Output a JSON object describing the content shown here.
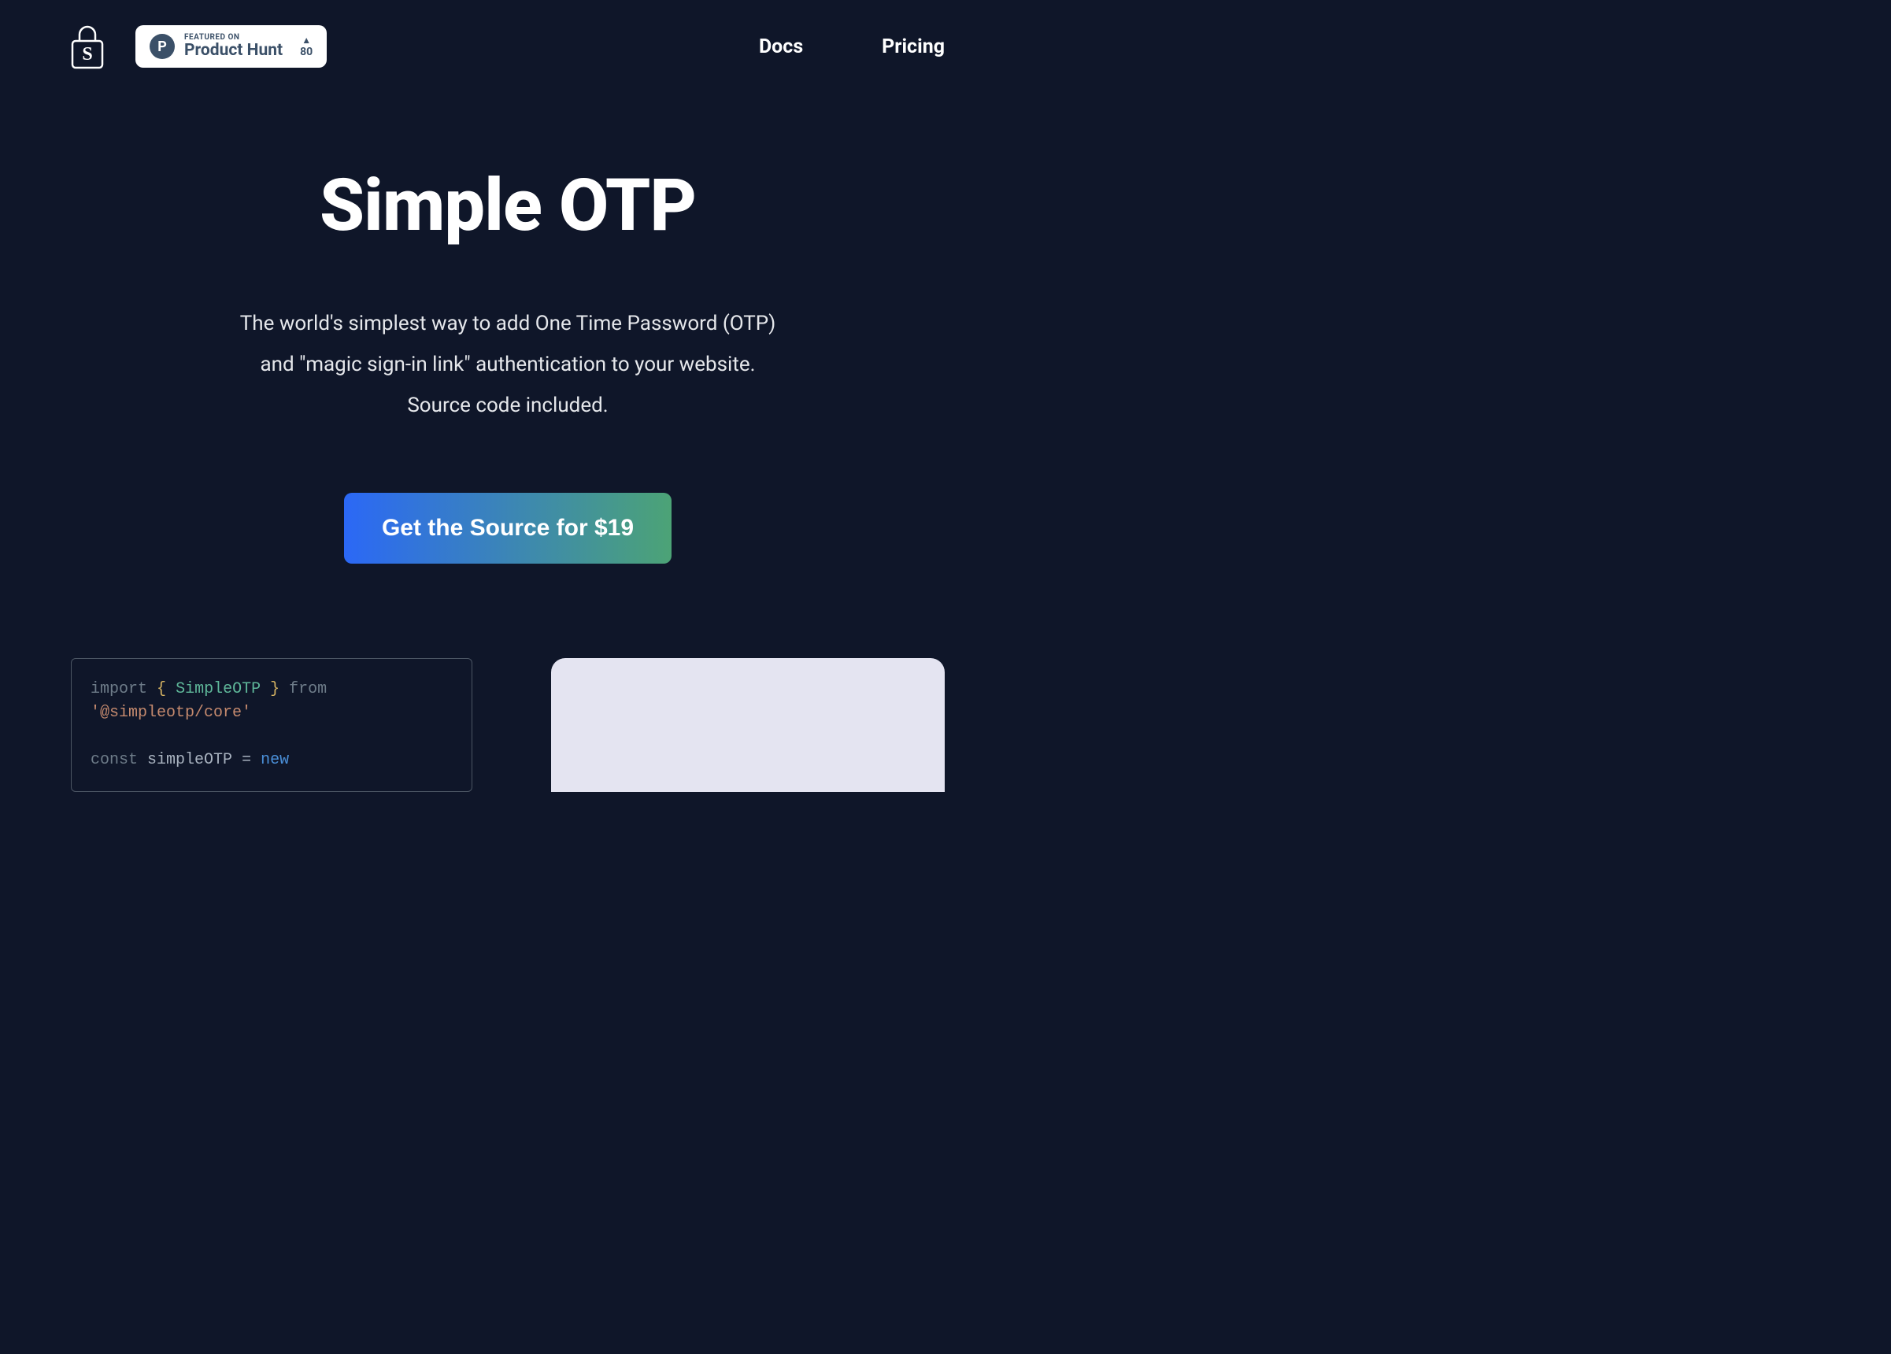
{
  "nav": {
    "docs": "Docs",
    "pricing": "Pricing"
  },
  "product_hunt": {
    "badge_letter": "P",
    "featured_label": "FEATURED ON",
    "name": "Product Hunt",
    "upvotes": "80"
  },
  "hero": {
    "title": "Simple OTP",
    "subtitle_line1": "The world's simplest way to add One Time Password (OTP)",
    "subtitle_line2": "and \"magic sign-in link\" authentication to your website.",
    "subtitle_line3": "Source code included."
  },
  "cta": {
    "label": "Get the Source for $19"
  },
  "code": {
    "kw_import": "import",
    "brace_open": "{",
    "class_name": "SimpleOTP",
    "brace_close": "}",
    "kw_from": "from",
    "pkg_string": "'@simpleotp/core'",
    "kw_const": "const",
    "var_name": "simpleOTP",
    "op_eq": "=",
    "kw_new": "new"
  }
}
